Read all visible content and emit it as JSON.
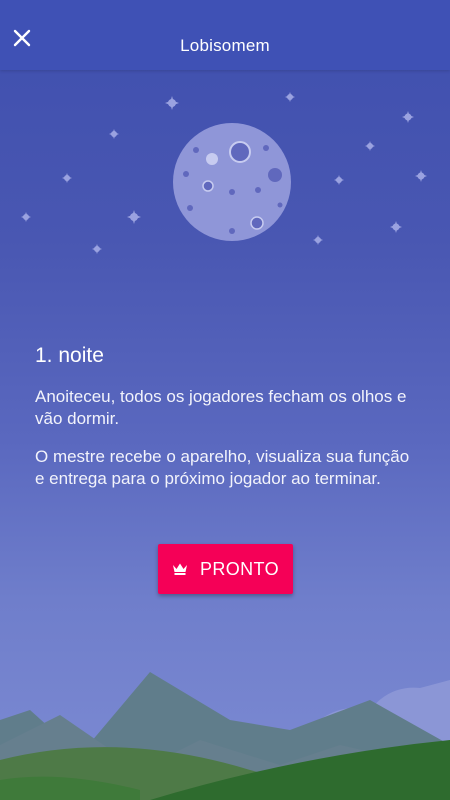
{
  "header": {
    "title": "Lobisomem",
    "close_icon": "close-icon"
  },
  "scene": {
    "moon_icon": "moon-icon",
    "stars_icon": "star-icon",
    "landscape_icon": "mountains-landscape"
  },
  "main": {
    "heading": "1. noite",
    "paragraph_1": "Anoiteceu, todos os jogadores fecham os olhos e vão dormir.",
    "paragraph_2": "O mestre recebe o aparelho, visualiza sua função e entrega para o próximo jogador ao terminar."
  },
  "action": {
    "button_label": "PRONTO",
    "button_icon": "crown-icon",
    "color": "#f50057"
  },
  "colors": {
    "topbar": "#3f51b5",
    "accent": "#f50057"
  }
}
